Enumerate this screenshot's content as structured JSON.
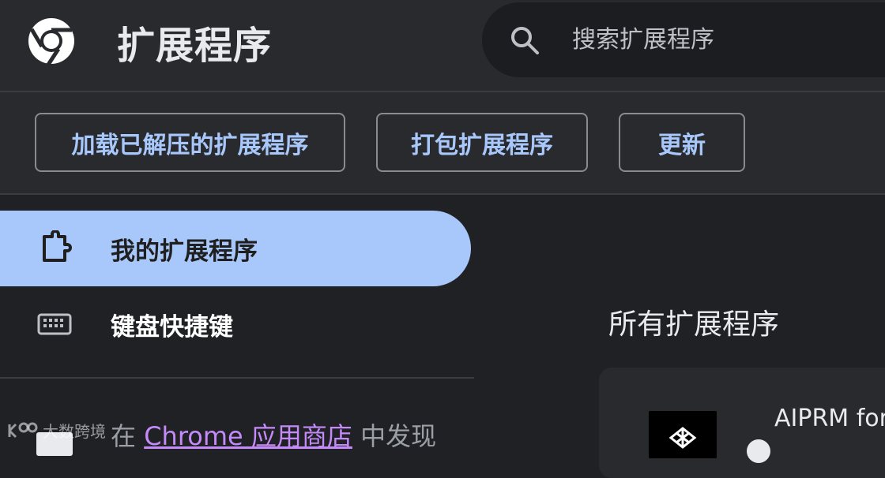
{
  "header": {
    "title": "扩展程序",
    "logo_icon": "chrome-logo",
    "search": {
      "placeholder": "搜索扩展程序",
      "value": "",
      "icon": "search-icon"
    }
  },
  "toolbar": {
    "load_unpacked_label": "加载已解压的扩展程序",
    "pack_label": "打包扩展程序",
    "update_label": "更新"
  },
  "sidebar": {
    "items": [
      {
        "label": "我的扩展程序",
        "icon": "puzzle-icon",
        "active": true
      },
      {
        "label": "键盘快捷键",
        "icon": "keyboard-icon",
        "active": false
      }
    ],
    "store": {
      "prefix": "在 ",
      "link_text": "Chrome 应用商店",
      "suffix": " 中发现"
    }
  },
  "main": {
    "section_title": "所有扩展程序",
    "extensions": [
      {
        "name": "AIPRM for",
        "icon": "aiprm-logo"
      }
    ]
  },
  "watermark": {
    "text": "大数跨境"
  },
  "colors": {
    "background": "#202124",
    "surface": "#292a2d",
    "accent": "#a8c7fa",
    "link": "#c58af9"
  }
}
